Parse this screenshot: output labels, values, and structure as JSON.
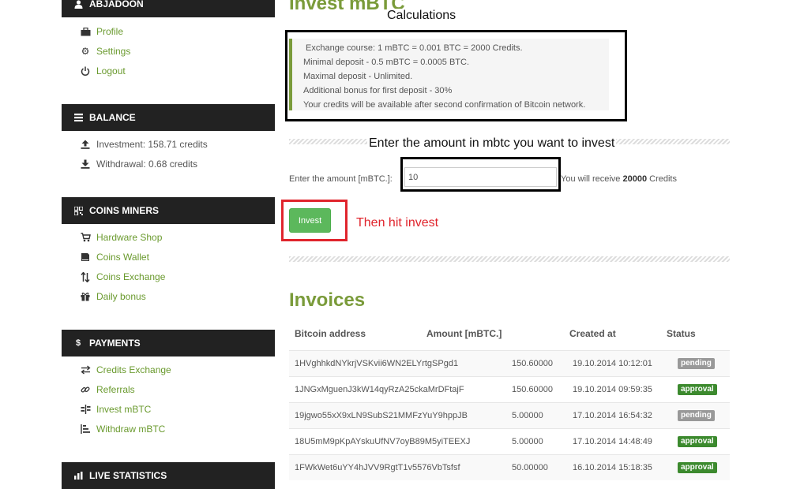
{
  "sidebar": {
    "user": {
      "name": "ABJADOON",
      "icon": "user-icon"
    },
    "account_links": [
      {
        "label": "Profile",
        "icon": "briefcase-icon"
      },
      {
        "label": "Settings",
        "icon": "gear-icon"
      },
      {
        "label": "Logout",
        "icon": "power-icon"
      }
    ],
    "balance": {
      "title": "BALANCE",
      "items": [
        {
          "label": "Investment: 158.71 credits",
          "icon": "upload-icon"
        },
        {
          "label": "Withdrawal: 0.68 credits",
          "icon": "download-icon"
        }
      ]
    },
    "coins_miners": {
      "title": "COINS MINERS",
      "items": [
        {
          "label": "Hardware Shop",
          "icon": "cart-icon"
        },
        {
          "label": "Coins Wallet",
          "icon": "wallet-icon"
        },
        {
          "label": "Coins Exchange",
          "icon": "exchange-icon"
        },
        {
          "label": "Daily bonus",
          "icon": "gift-icon"
        }
      ]
    },
    "payments": {
      "title": "PAYMENTS",
      "items": [
        {
          "label": "Credits Exchange",
          "icon": "transfer-icon"
        },
        {
          "label": "Referrals",
          "icon": "link-icon"
        },
        {
          "label": "Invest mBTC",
          "icon": "invest-icon"
        },
        {
          "label": "Withdraw mBTC",
          "icon": "withdraw-icon"
        }
      ]
    },
    "live_statistics": {
      "title": "LIVE STATISTICS",
      "icon": "bar-chart-icon"
    }
  },
  "main": {
    "invest_title": "Invest mBTC",
    "annotation_calculations": "Calculations",
    "info_lines": [
      "Exchange course: 1 mBTC = 0.001 BTC = 2000 Credits.",
      "Minimal deposit - 0.5 mBTC = 0.0005 BTC.",
      "Maximal deposit - Unlimited.",
      "Additional bonus for first deposit - 30%",
      "Your credits will be available after second confirmation of Bitcoin network."
    ],
    "annotation_enter_amount": "Enter the amount in mbtc you want to invest",
    "amount_label": "Enter the amount [mBTC.]:",
    "amount_value": "10",
    "receive_prefix": "You will receive",
    "receive_credits": "20000",
    "receive_suffix": "Credits",
    "invest_button": "Invest",
    "annotation_then_hit": "Then hit invest",
    "invoices_title": "Invoices",
    "invoice_headers": [
      "Bitcoin address",
      "Amount [mBTC.]",
      "Created at",
      "Status"
    ],
    "invoices": [
      {
        "address": "1HVghhkdNYkrjVSKvii6WN2ELYrtgSPgd1",
        "amount": "150.60000",
        "created": "19.10.2014 10:12:01",
        "status": "pending"
      },
      {
        "address": "1JNGxMguenJ3kW14qyRzA25ckaMrDFtajF",
        "amount": "150.60000",
        "created": "19.10.2014 09:59:35",
        "status": "approval"
      },
      {
        "address": "19jgwo55xX9xLN9SubS21MMFzYuY9hppJB",
        "amount": "5.00000",
        "created": "17.10.2014 16:54:32",
        "status": "pending"
      },
      {
        "address": "18U5mM9pKpAYskuUfNV7oyB89M5yiTEEXJ",
        "amount": "5.00000",
        "created": "17.10.2014 14:48:49",
        "status": "approval"
      },
      {
        "address": "1FWkWet6uYY4hJVV9RgtT1v5576VbTsfsf",
        "amount": "50.00000",
        "created": "16.10.2014 15:18:35",
        "status": "approval"
      }
    ]
  },
  "colors": {
    "accent_green": "#7a9b3a",
    "pending_badge": "#999999",
    "approval_badge": "#3c8a2e",
    "annotation_red": "#e0242c",
    "panel_dark": "#222222"
  }
}
